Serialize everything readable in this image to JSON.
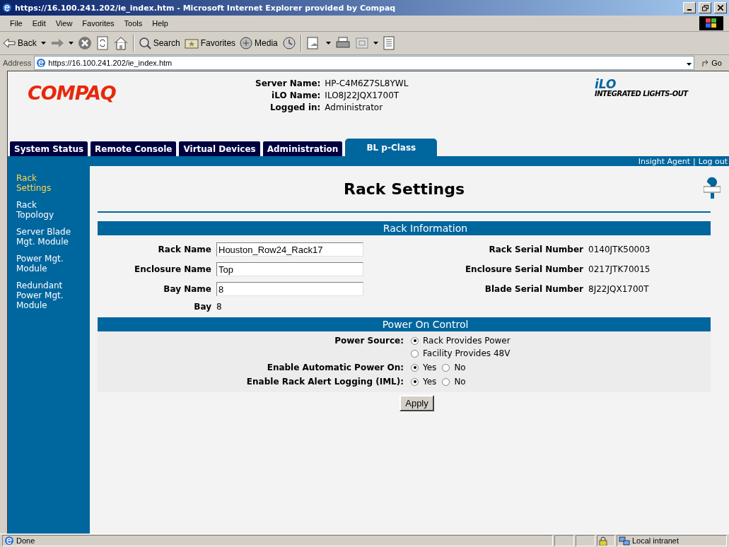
{
  "window": {
    "title": "https://16.100.241.202/ie_index.htm - Microsoft Internet Explorer provided by Compaq"
  },
  "menu": [
    "File",
    "Edit",
    "View",
    "Favorites",
    "Tools",
    "Help"
  ],
  "toolbar": [
    "Back",
    "Search",
    "Favorites",
    "Media"
  ],
  "address": {
    "label": "Address",
    "value": "https://16.100.241.202/ie_index.htm",
    "go": "Go"
  },
  "header": {
    "logo": "COMPAQ",
    "info": [
      {
        "label": "Server Name:",
        "value": "HP-C4M6Z7SL8YWL"
      },
      {
        "label": "iLO Name:",
        "value": "ILO8J22JQX1700T"
      },
      {
        "label": "Logged in:",
        "value": "Administrator"
      }
    ],
    "product": {
      "name": "iLO",
      "subtitle": "INTEGRATED LIGHTS-OUT"
    }
  },
  "tabs": [
    {
      "label": "System Status",
      "selected": false
    },
    {
      "label": "Remote Console",
      "selected": false
    },
    {
      "label": "Virtual Devices",
      "selected": false
    },
    {
      "label": "Administration",
      "selected": false
    },
    {
      "label": "BL p-Class",
      "selected": true
    }
  ],
  "top_links": {
    "items": [
      "Insight Agent",
      "Log out"
    ],
    "separator": "|"
  },
  "sidebar": {
    "items": [
      {
        "label": "Rack Settings",
        "selected": true
      },
      {
        "label": "Rack Topology",
        "selected": false
      },
      {
        "label": "Server Blade Mgt. Module",
        "selected": false
      },
      {
        "label": "Power Mgt. Module",
        "selected": false
      },
      {
        "label": "Redundant Power Mgt. Module",
        "selected": false
      }
    ]
  },
  "page_title": "Rack Settings",
  "rack_information": {
    "title": "Rack Information",
    "rows": [
      {
        "label": "Rack Name",
        "kind": "input",
        "value": "Houston_Row24_Rack17",
        "serial_label": "Rack Serial Number",
        "serial": "0140JTK50003"
      },
      {
        "label": "Enclosure Name",
        "kind": "input",
        "value": "Top",
        "serial_label": "Enclosure Serial Number",
        "serial": "0217JTK70015"
      },
      {
        "label": "Bay Name",
        "kind": "input",
        "value": "8",
        "serial_label": "Blade Serial Number",
        "serial": "8J22JQX1700T"
      },
      {
        "label": "Bay",
        "kind": "text",
        "value": "8"
      }
    ]
  },
  "power_on_control": {
    "title": "Power On Control",
    "rows": [
      {
        "label": "Power Source:",
        "kind": "stacked",
        "options": [
          {
            "label": "Rack Provides Power",
            "selected": true
          },
          {
            "label": "Facility Provides 48V",
            "selected": false
          }
        ]
      },
      {
        "label": "Enable Automatic Power On:",
        "kind": "inline",
        "options": [
          {
            "label": "Yes",
            "selected": true
          },
          {
            "label": "No",
            "selected": false
          }
        ]
      },
      {
        "label": "Enable Rack Alert Logging (IML):",
        "kind": "inline",
        "options": [
          {
            "label": "Yes",
            "selected": true
          },
          {
            "label": "No",
            "selected": false
          }
        ]
      }
    ]
  },
  "apply_button": "Apply",
  "status_bar": {
    "text": "Done",
    "zone": "Local intranet"
  }
}
